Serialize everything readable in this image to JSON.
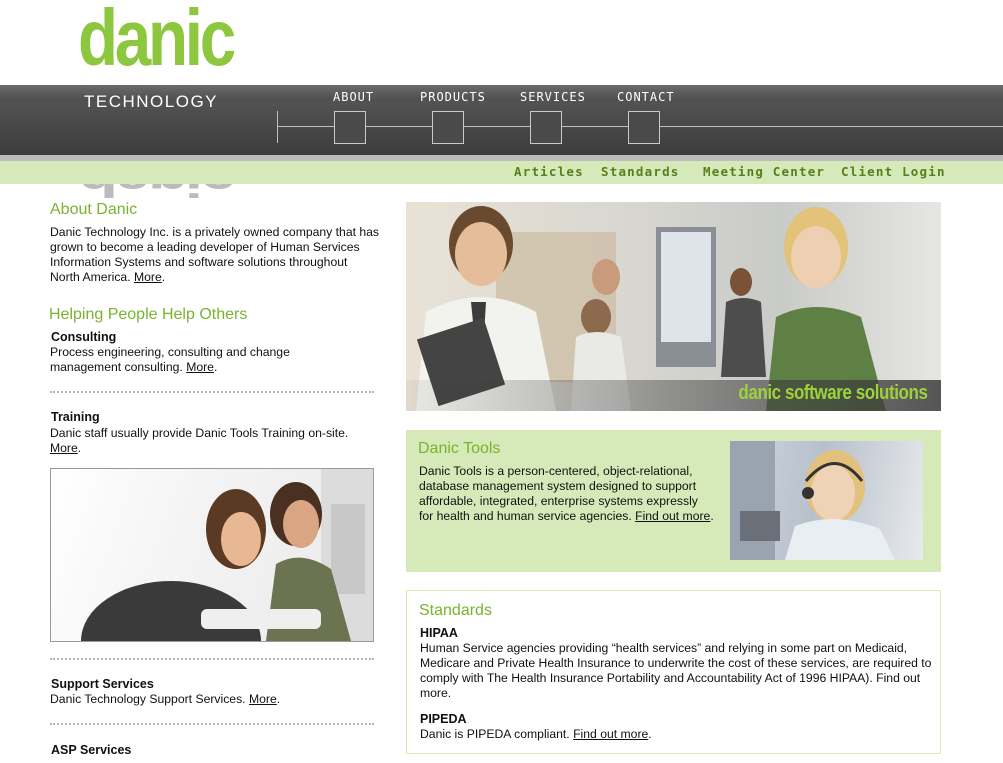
{
  "logo": {
    "word": "danic",
    "sub": "TECHNOLOGY"
  },
  "nav": [
    "ABOUT",
    "PRODUCTS",
    "SERVICES",
    "CONTACT"
  ],
  "subnav": [
    "Articles",
    "Standards",
    "Meeting Center",
    "Client Login"
  ],
  "about": {
    "title": "About Danic",
    "text": "Danic Technology Inc. is a privately owned company that has grown to become a leading developer of Human Services Information Systems and software solutions throughout North America.",
    "more": "More"
  },
  "helping": {
    "title": "Helping People Help Others",
    "consulting": {
      "title": "Consulting",
      "text": "Process engineering, consulting and change management consulting.",
      "more": "More"
    },
    "training": {
      "title": "Training",
      "text": "Danic staff usually provide Danic Tools Training on-site.",
      "more": "More"
    },
    "support": {
      "title": "Support Services",
      "text": "Danic Technology Support Services.",
      "more": "More"
    },
    "asp": {
      "title": "ASP Services"
    }
  },
  "hero": {
    "caption": "danic software solutions"
  },
  "tools": {
    "title": "Danic Tools",
    "text": "Danic Tools is a person-centered, object-relational, database management system designed to support affordable, integrated, enterprise systems expressly for health and human service agencies.",
    "more": "Find out more"
  },
  "standards": {
    "title": "Standards",
    "hipaa": {
      "title": "HIPAA",
      "text": "Human Service agencies providing “health services” and relying in some part on Medicaid, Medicare and Private Health Insurance to underwrite the cost of these services, are required to comply with The Health Insurance Portability and Accountability Act of 1996 HIPAA). Find out more."
    },
    "pipeda": {
      "title": "PIPEDA",
      "text": "Danic is PIPEDA compliant.",
      "more": "Find out more"
    }
  }
}
